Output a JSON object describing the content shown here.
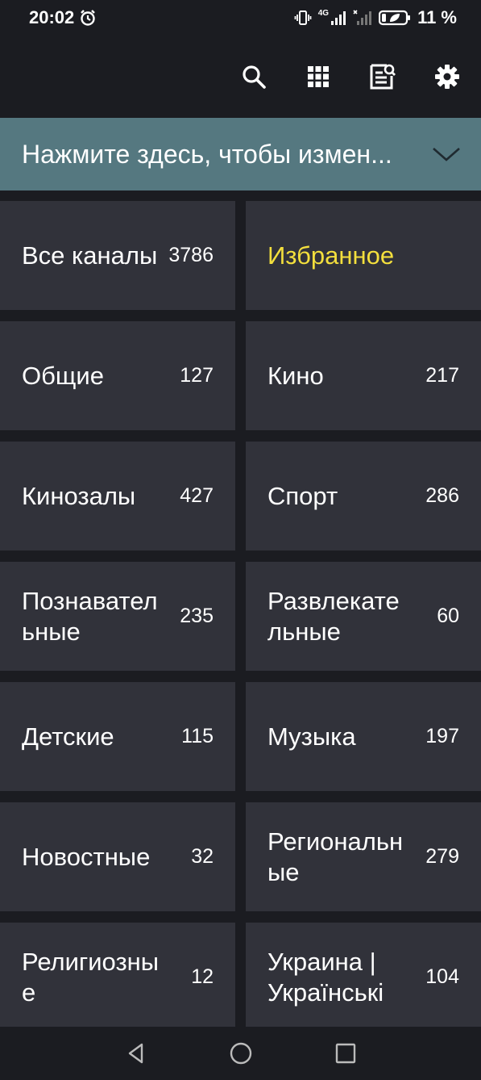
{
  "status_bar": {
    "time": "20:02",
    "network": "4G",
    "battery": "11 %",
    "icons": [
      "alarm-icon",
      "vibrate-icon",
      "signal-icon",
      "no-signal-icon",
      "battery-icon"
    ]
  },
  "toolbar": {
    "icons": [
      "search-icon",
      "apps-grid-icon",
      "tv-guide-icon",
      "settings-icon"
    ]
  },
  "group_selector": {
    "label": "Нажмите здесь, чтобы измен...",
    "icon": "chevron-down-icon",
    "color": "#557880"
  },
  "categories": [
    {
      "name": "Все каналы",
      "count": "3786"
    },
    {
      "name": "Избранное",
      "count": ""
    },
    {
      "name": "Общие",
      "count": "127"
    },
    {
      "name": "Кино",
      "count": "217"
    },
    {
      "name": "Кинозалы",
      "count": "427"
    },
    {
      "name": "Спорт",
      "count": "286"
    },
    {
      "name": "Познавательные",
      "count": "235"
    },
    {
      "name": "Развлекательные",
      "count": "60"
    },
    {
      "name": "Детские",
      "count": "115"
    },
    {
      "name": "Музыка",
      "count": "197"
    },
    {
      "name": "Новостные",
      "count": "32"
    },
    {
      "name": "Региональные",
      "count": "279"
    },
    {
      "name": "Религиозные",
      "count": "12"
    },
    {
      "name": "Украина | Українські",
      "count": "104"
    }
  ],
  "colors": {
    "background": "#1b1c21",
    "tile": "#31323a",
    "favorite_text": "#f3df3d"
  },
  "nav_bar": {
    "icons": [
      "back-icon",
      "home-icon",
      "recents-icon"
    ]
  }
}
